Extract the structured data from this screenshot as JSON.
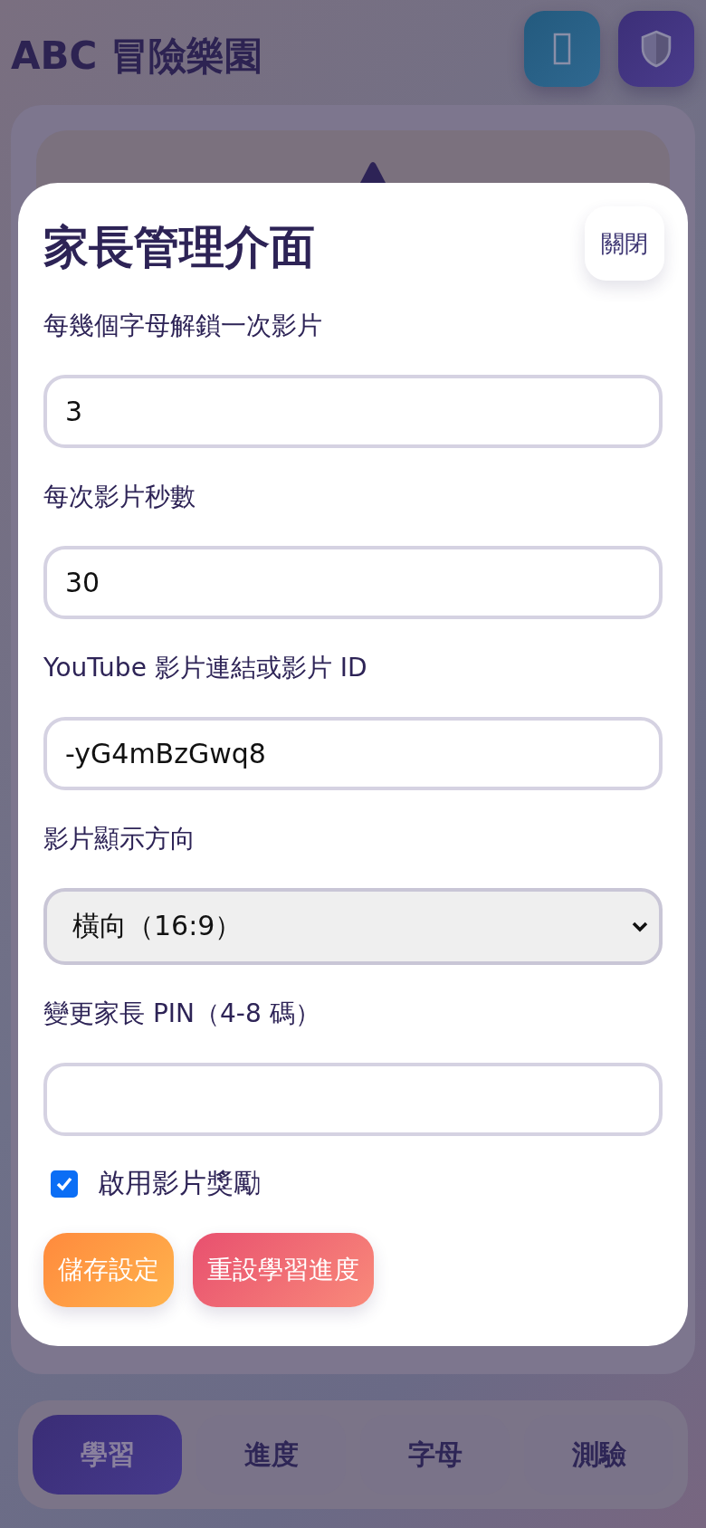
{
  "header": {
    "logo": "ABC 冒險樂園"
  },
  "modal": {
    "title": "家長管理介面",
    "close_button": "關閉",
    "fields": [
      {
        "kind": "input",
        "label": "每幾個字母解鎖一次影片",
        "value": "3"
      },
      {
        "kind": "input",
        "label": "每次影片秒數",
        "value": "30"
      },
      {
        "kind": "input",
        "label": "YouTube 影片連結或影片 ID",
        "value": "-yG4mBzGwq8"
      },
      {
        "kind": "select",
        "label": "影片顯示方向",
        "value": "橫向（16:9）"
      },
      {
        "kind": "input",
        "label": "變更家長 PIN（4-8 碼）"
      }
    ],
    "checkbox": {
      "label": "啟用影片獎勵",
      "checked": true
    },
    "buttons": [
      {
        "label": "儲存設定",
        "kind": "save"
      },
      {
        "label": "重設學習進度",
        "kind": "reset"
      }
    ]
  },
  "nav_tabs": [
    {
      "label": "學習",
      "selected": true
    },
    {
      "label": "進度",
      "selected": false
    },
    {
      "label": "字母",
      "selected": false
    },
    {
      "label": "測驗",
      "selected": false
    }
  ]
}
